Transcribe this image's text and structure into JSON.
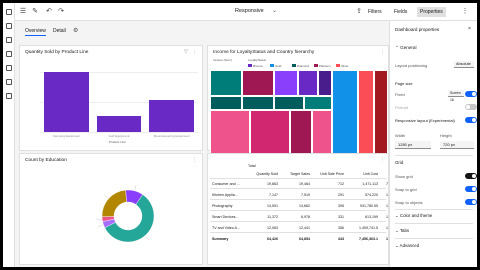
{
  "app": {
    "doc_title": "Responsive",
    "toolbar": {
      "filters": "Filters",
      "fields": "Fields",
      "properties": "Properties"
    }
  },
  "tabs": [
    {
      "label": "Overview"
    },
    {
      "label": "Detail"
    }
  ],
  "cards": {
    "bar": {
      "title": "Quantity Sold by Product Line",
      "chart_data": {
        "type": "bar",
        "categories": [
          "Camping Equipment",
          "Golf Equipment",
          "Mountaineering Equipment"
        ],
        "values": [
          100,
          27,
          53
        ],
        "xlabel": "Product Line",
        "color": "#6929c4"
      }
    },
    "treemap": {
      "title": "Income for LoyaltyStatus and Country hierarchy",
      "legend_title_left": "Income (Sum)",
      "legend_title_right": "LoyaltyStatus",
      "legend": [
        "Bronze",
        "Gold",
        "Diamond",
        "Platinum",
        "Silver"
      ],
      "legend_colors": [
        "#6929c4",
        "#1192e8",
        "#005d5d",
        "#9f1853",
        "#fa4d56"
      ]
    },
    "donut": {
      "title": "Count by Education",
      "chart_data": {
        "type": "pie",
        "values": [
          58,
          4,
          3,
          24,
          11
        ],
        "colors": [
          "#24a699",
          "#a56eff",
          "#ee538b",
          "#b28600",
          "#8a3ffc"
        ]
      }
    },
    "table": {
      "header_group": "Total",
      "columns": [
        "",
        "Quantity Sold",
        "Target Sales",
        "Unit Sale Price",
        "Unit Cost",
        ""
      ],
      "rows": [
        [
          "Consumer and ...",
          "19,663",
          "19,464",
          "712",
          "1,471,113",
          "7"
        ],
        [
          "Kitchen Applia...",
          "7,147",
          "7,519",
          "291",
          "574,220",
          "1"
        ],
        [
          "Photography",
          "14,501",
          "14,662",
          "395",
          "931,780.55",
          "1"
        ],
        [
          "Smart Devices...",
          "11,372",
          "6,978",
          "331",
          "613,199",
          "1"
        ],
        [
          "TV and Video A...",
          "12,063",
          "12,441",
          "356",
          "1,409,741.5",
          "1"
        ]
      ],
      "summary": [
        "Summary",
        "64,426",
        "64,854",
        "343",
        "7,456,363.1",
        "1"
      ]
    }
  },
  "properties": {
    "title": "Dashboard properties",
    "general_section": "General",
    "layout_positioning_label": "Layout positioning",
    "layout_positioning_value": "Absolute",
    "page_size_label": "Page size",
    "fixed_label": "Fixed",
    "fixed_value": "Screen 16",
    "portrait_label": "Portrait",
    "responsive_label": "Responsive layout (Experimental)",
    "width_label": "Width",
    "height_label": "Height",
    "width_value": "1280 px",
    "height_value": "720 px",
    "grid_section": "Grid",
    "show_grid_label": "Show grid",
    "snap_to_grid_label": "Snap to grid",
    "snap_to_objects_label": "Snap to objects",
    "color_theme_section": "Color and theme",
    "tabs_section": "Tabs",
    "advanced_section": "Advanced",
    "toggles": {
      "fixed": true,
      "portrait": false,
      "responsive": true,
      "show_grid": true,
      "snap_to_grid": true,
      "snap_to_objects": true
    },
    "accent": "#0f62fe"
  }
}
